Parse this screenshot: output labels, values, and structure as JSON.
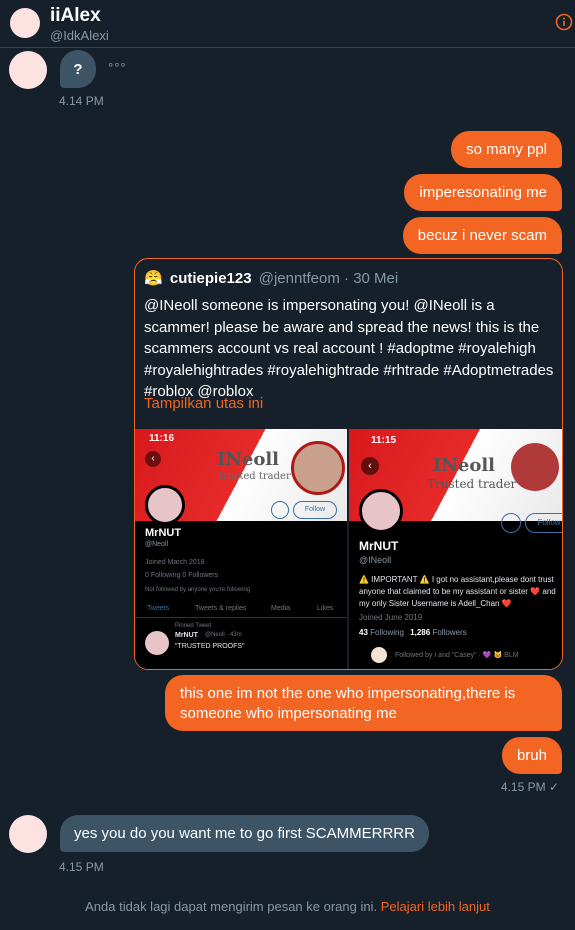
{
  "header": {
    "name": "iiAlex",
    "handle": "@IdkAlexi",
    "info_icon": "info-circle-icon"
  },
  "messages": {
    "m1_text": "?",
    "m1_reaction": "°°°",
    "m1_time": "4.14 PM",
    "out1": "so many ppl",
    "out2": "imperesonating me",
    "out3": "becuz i never scam",
    "out4": "this one im not the one who impersonating,there is someone who impersonating me",
    "out5": "bruh",
    "out_time": "4.15 PM ✓",
    "in2": "yes you do you want me to go first SCAMMERRRR",
    "in2_time": "4.15 PM"
  },
  "tweet": {
    "emoji": "😤",
    "name": "cutiepie123",
    "handle": "@jenntfeom",
    "date": "· 30 Mei",
    "text": "@INeoll someone is impersonating you! @INeoll is a scammer! please be aware and spread the news! this is the scammers account vs real account ! #adoptme #royalehigh #royalehightrades #royalehightrade #rhtrade #Adoptmetrades #roblox @roblox",
    "show_thread": "Tampilkan utas ini",
    "left": {
      "time": "11:16",
      "banner": "INeoll",
      "banner_sub": "trusted trader",
      "follow": "Follow",
      "name": "MrNUT",
      "handle": "@Neoll",
      "joined": "Joined March 2018",
      "stats": "0 Following  0 Followers",
      "note": "Not followed by anyone you're following",
      "tabs": [
        "Tweets",
        "Tweets & replies",
        "Media",
        "Likes"
      ],
      "pinned": "Pinned Tweet",
      "p_name": "MrNUT",
      "p_handle": "@Neoll · 43m",
      "p_text": "\"TRUSTED PROOFS\""
    },
    "right": {
      "time": "11:15",
      "banner": "INeoll",
      "banner_sub": "Trusted trader",
      "follow": "Follow",
      "name": "MrNUT",
      "handle": "@INeoll",
      "bio": "⚠️ IMPORTANT ⚠️ I got no assistant,please dont trust anyone that claimed to be my assistant or sister ❤️ and my only Sister Username is Adell_Chan ❤️",
      "joined": "Joined June 2019",
      "following_num": "43",
      "following_label": "Following",
      "followers_num": "1,286",
      "followers_label": "Followers",
      "followed_by": "Followed by I and \"Casey\" · 💜 🐱 BLM"
    }
  },
  "footer": {
    "text": "Anda tidak lagi dapat mengirim pesan ke orang ini.",
    "link": "Pelajari lebih lanjut"
  },
  "colors": {
    "accent": "#f26522",
    "background": "#15202b",
    "bubble_in": "#3d5466"
  }
}
